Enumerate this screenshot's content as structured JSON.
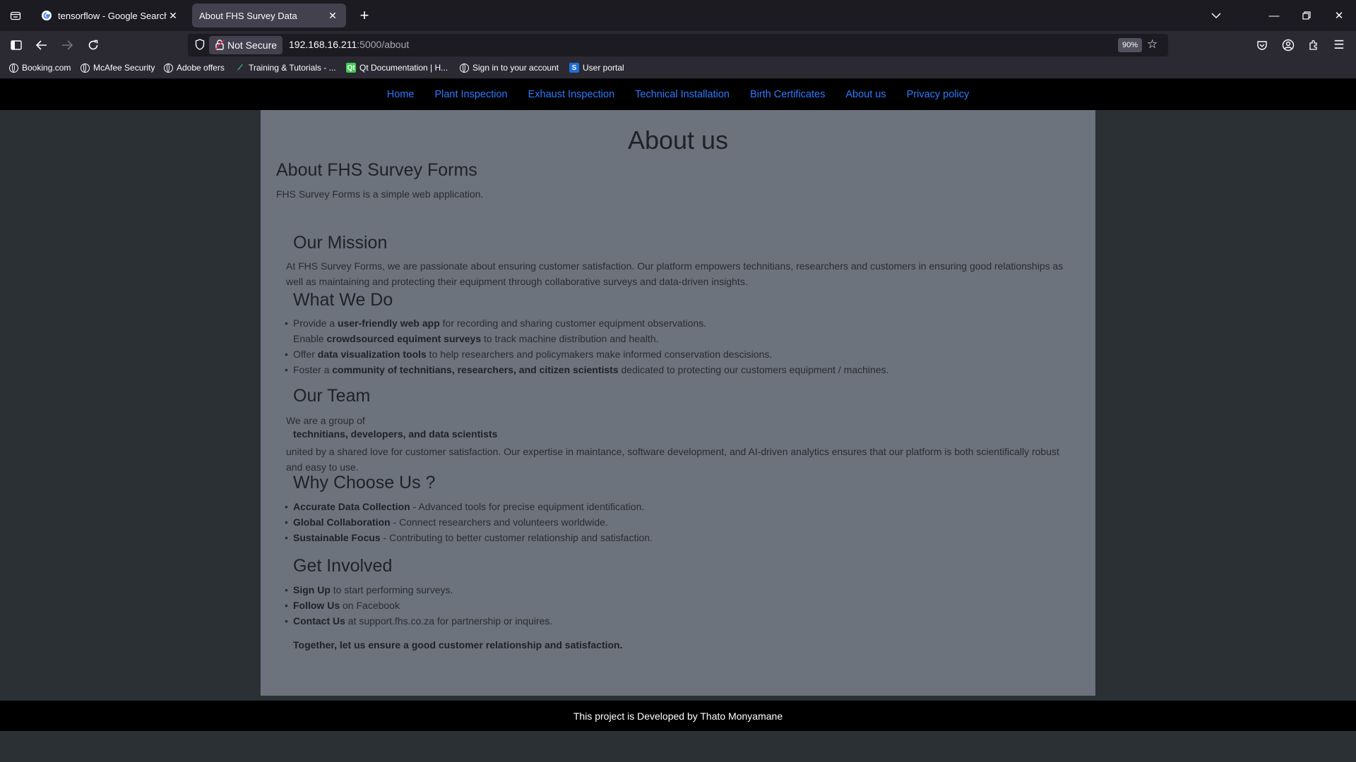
{
  "browser": {
    "tabs": [
      {
        "title": "tensorflow - Google Search"
      },
      {
        "title": "About FHS Survey Data"
      }
    ],
    "security_label": "Not Secure",
    "url_host": "192.168.16.211",
    "url_path": ":5000/about",
    "zoom": "90%",
    "bookmarks": [
      {
        "label": "Booking.com"
      },
      {
        "label": "McAfee Security"
      },
      {
        "label": "Adobe offers"
      },
      {
        "label": "Training & Tutorials - ..."
      },
      {
        "label": "Qt Documentation | H..."
      },
      {
        "label": "Sign in to your account"
      },
      {
        "label": "User portal"
      }
    ]
  },
  "nav": {
    "links": [
      "Home",
      "Plant Inspection",
      "Exhaust Inspection",
      "Technical Installation",
      "Birth Certificates",
      "About us",
      "Privacy policy"
    ],
    "link_color": "#2d7bff"
  },
  "page": {
    "title": "About us",
    "subtitle": "About FHS Survey Forms",
    "intro": "FHS Survey Forms is a simple web application.",
    "mission": {
      "heading": "Our Mission",
      "text": "At FHS Survey Forms, we are passionate about ensuring customer satisfaction. Our platform empowers technitians, researchers and customers in ensuring good relationships as well as maintaining and protecting their equipment through collaborative surveys and data-driven insights."
    },
    "what_we_do": {
      "heading": "What We Do",
      "items": [
        {
          "pre": "Provide a ",
          "bold": "user-friendly web app",
          "post": " for recording and sharing customer equipment observations."
        },
        {
          "pre": "Enable ",
          "bold": "crowdsourced equiment surveys",
          "post": " to track machine distribution and health."
        },
        {
          "pre": "Offer ",
          "bold": "data visualization tools",
          "post": " to help researchers and policymakers make informed conservation descisions."
        },
        {
          "pre": "Foster a ",
          "bold": "community of technitians, researchers, and citizen scientists",
          "post": " dedicated to protecting our customers equipment / machines."
        }
      ]
    },
    "team": {
      "heading": "Our Team",
      "line1": "We are a group of",
      "bold": "technitians, developers, and data scientists",
      "text": "united by a shared love for customer satisfaction. Our expertise in maintance, software development, and AI-driven analytics ensures that our platform is both scientifically robust and easy to use."
    },
    "why": {
      "heading": "Why Choose Us ?",
      "items": [
        {
          "bold": "Accurate Data Collection",
          "post": " - Advanced tools for precise equipment identification."
        },
        {
          "bold": "Global Collaboration",
          "post": " - Connect researchers and volunteers worldwide."
        },
        {
          "bold": "Sustainable Focus",
          "post": " - Contributing to better customer relationship and satisfaction."
        }
      ]
    },
    "involved": {
      "heading": "Get Involved",
      "items": [
        {
          "bold": "Sign Up",
          "post": " to start performing surveys."
        },
        {
          "bold": "Follow Us",
          "post": " on Facebook"
        },
        {
          "bold": "Contact Us",
          "post": " at support.fhs.co.za for partnership or inquires."
        }
      ],
      "closing": "Together, let us ensure a good customer relationship and satisfaction."
    }
  },
  "footer": {
    "text": "This project is Developed by Thato Monyamane"
  }
}
